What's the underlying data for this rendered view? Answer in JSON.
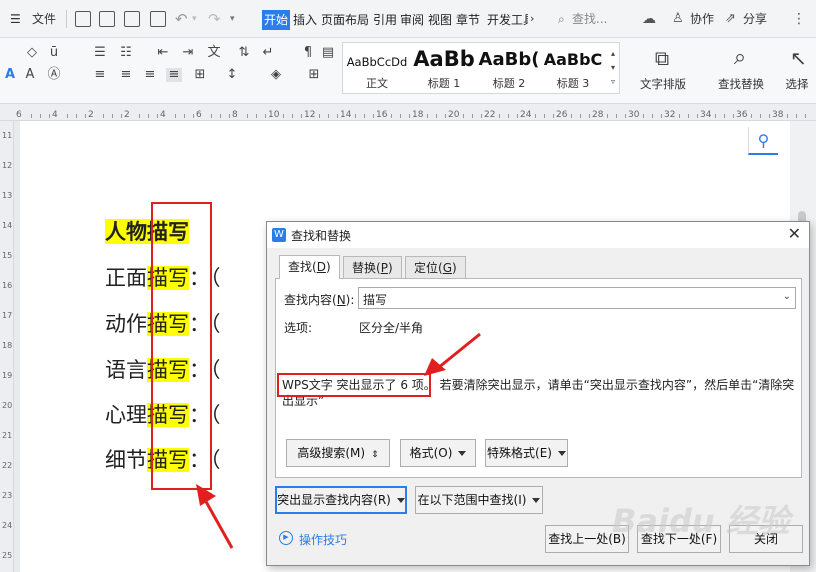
{
  "menu": {
    "file_label": "文件",
    "tabs": [
      "开始",
      "插入",
      "页面布局",
      "引用",
      "审阅",
      "视图",
      "章节",
      "开发工具"
    ],
    "search_label": "查找...",
    "collab_label": "协作",
    "share_label": "分享"
  },
  "ribbon": {
    "styles": [
      {
        "sample": "AaBbCcDd",
        "name": "正文"
      },
      {
        "sample": "AaBb",
        "name": "标题 1"
      },
      {
        "sample": "AaBb(",
        "name": "标题 2"
      },
      {
        "sample": "AaBbC",
        "name": "标题 3"
      }
    ],
    "text_layout_label": "文字排版",
    "find_replace_label": "查找替换",
    "select_label": "选择"
  },
  "ruler": {
    "ticks": [
      "6",
      "4",
      "2",
      "2",
      "4",
      "6",
      "8",
      "10",
      "12",
      "14",
      "16",
      "18",
      "20",
      "22",
      "24",
      "26",
      "28",
      "30",
      "32",
      "34",
      "36",
      "38"
    ],
    "vticks": [
      "11",
      "12",
      "13",
      "14",
      "15",
      "16",
      "17",
      "18",
      "19",
      "20",
      "21",
      "22",
      "23",
      "24",
      "25"
    ]
  },
  "document": {
    "title_prefix": "人物",
    "title_hl": "描写",
    "lines": [
      {
        "prefix": "正面",
        "hl": "描写",
        "suffix": "：（"
      },
      {
        "prefix": "动作",
        "hl": "描写",
        "suffix": "：（"
      },
      {
        "prefix": "语言",
        "hl": "描写",
        "suffix": "：（"
      },
      {
        "prefix": "心理",
        "hl": "描写",
        "suffix": "：（"
      },
      {
        "prefix": "细节",
        "hl": "描写",
        "suffix": "：（"
      }
    ]
  },
  "dialog": {
    "title": "查找和替换",
    "tabs": [
      {
        "label": "查找(",
        "key": "D",
        "end": ")"
      },
      {
        "label": "替换(",
        "key": "P",
        "end": ")"
      },
      {
        "label": "定位(",
        "key": "G",
        "end": ")"
      }
    ],
    "find_label_a": "查找内容(",
    "find_label_key": "N",
    "find_label_b": "):",
    "find_value": "描写",
    "options_label": "选项:",
    "options_value": "区分全/半角",
    "result_highlight": "WPS文字 突出显示了 6 项。",
    "result_rest": "若要清除突出显示，请单击“突出显示查找内容”，然后单击“清除突出显示”",
    "adv_search": "高级搜索(M)",
    "format": "格式(O)",
    "special": "特殊格式(E)",
    "highlight_btn": "突出显示查找内容(R)",
    "find_in_btn": "在以下范围中查找(I)",
    "tips": "操作技巧",
    "prev_btn": "查找上一处(B)",
    "next_btn": "查找下一处(F)",
    "close_btn": "关闭"
  },
  "watermark": "Baidu 经验",
  "colors": {
    "accent": "#2b7de9",
    "highlight": "#ffff00",
    "annotation": "#e02020"
  }
}
